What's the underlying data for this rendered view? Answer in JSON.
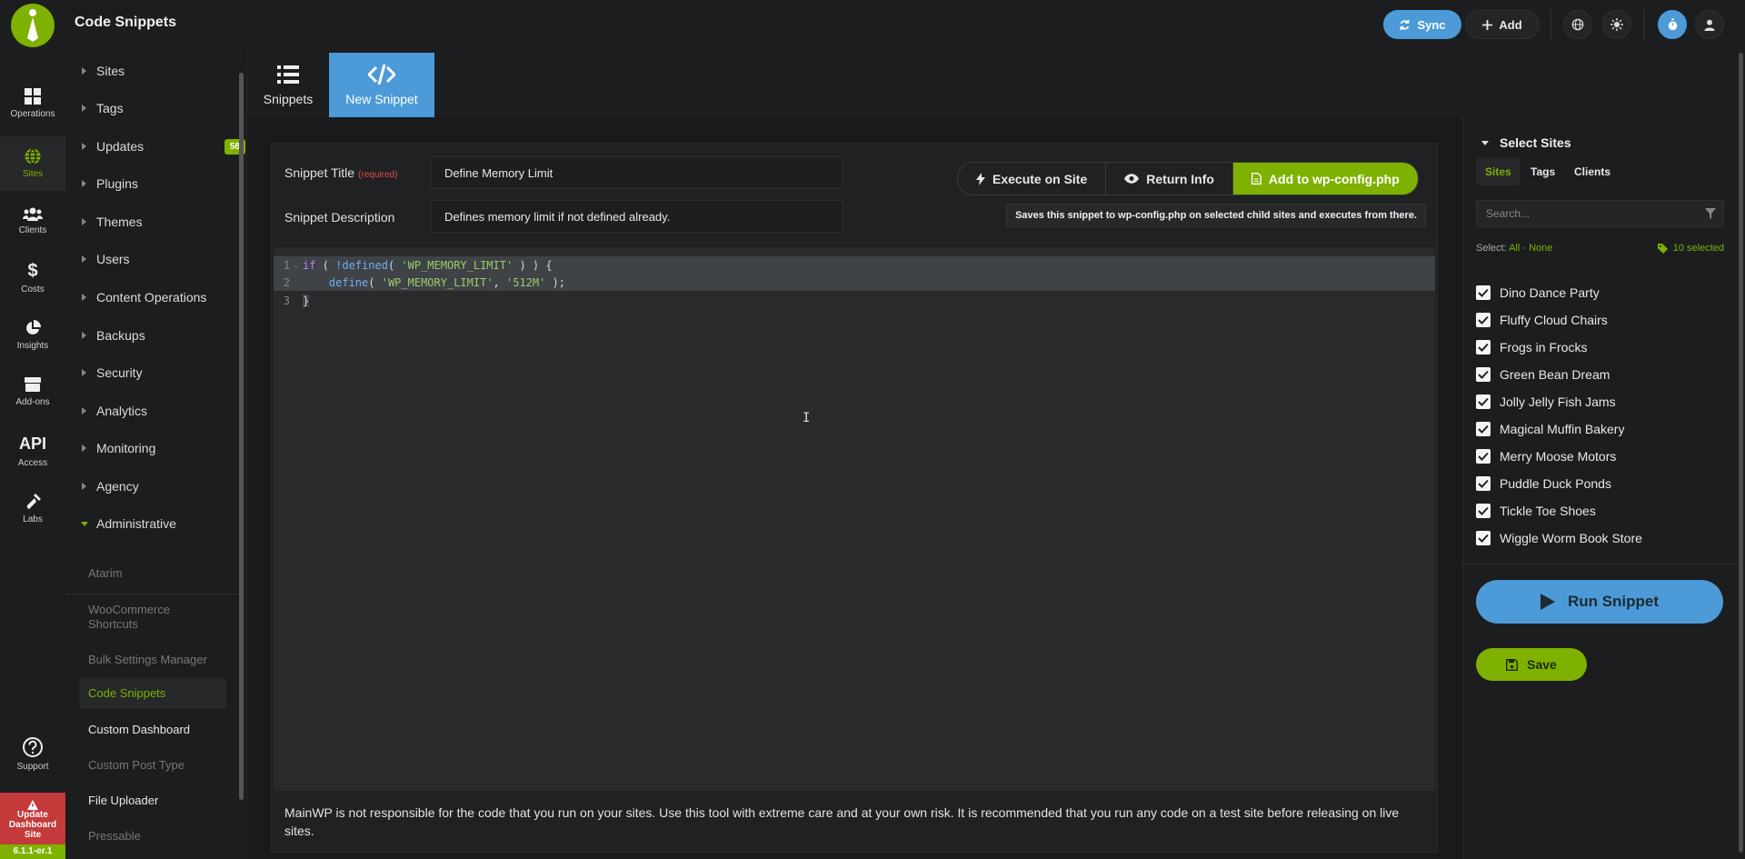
{
  "app": {
    "title": "Code Snippets",
    "version": "6.1.1-er.1"
  },
  "topbar": {
    "sync_label": "Sync",
    "add_label": "Add"
  },
  "iconbar": [
    {
      "label": "Operations",
      "icon": "grid-icon"
    },
    {
      "label": "Sites",
      "icon": "globe-icon"
    },
    {
      "label": "Clients",
      "icon": "users-icon"
    },
    {
      "label": "Costs",
      "icon": "dollar-icon"
    },
    {
      "label": "Insights",
      "icon": "pie-chart-icon"
    },
    {
      "label": "Add-ons",
      "icon": "box-icon"
    },
    {
      "label": "Access",
      "icon_text": "API"
    },
    {
      "label": "Labs",
      "icon": "flask-icon"
    },
    {
      "label": "Support",
      "icon": "help-icon"
    }
  ],
  "update_site": {
    "line1": "Update",
    "line2": "Dashboard",
    "line3": "Site"
  },
  "nav": {
    "items": [
      "Sites",
      "Tags",
      "Updates",
      "Plugins",
      "Themes",
      "Users",
      "Content Operations",
      "Backups",
      "Security",
      "Analytics",
      "Monitoring",
      "Agency",
      "Administrative"
    ],
    "updates_badge": "58",
    "sub_items": [
      "Atarim",
      "WooCommerce Shortcuts",
      "Bulk Settings Manager",
      "Code Snippets",
      "Custom Dashboard",
      "Custom Post Type",
      "File Uploader",
      "Pressable"
    ]
  },
  "tabs": {
    "snippets": "Snippets",
    "new_snippet": "New Snippet"
  },
  "form": {
    "title_label": "Snippet Title",
    "required_label": "(required)",
    "title_value": "Define Memory Limit",
    "desc_label": "Snippet Description",
    "desc_value": "Defines memory limit if not defined already."
  },
  "actions": {
    "execute": "Execute on Site",
    "return_info": "Return Info",
    "wp_config": "Add to wp-config.php",
    "tooltip": "Saves this snippet to wp-config.php on selected child sites and executes from there."
  },
  "code": {
    "line_numbers": [
      "1",
      "2",
      "3"
    ],
    "l1_kw": "if",
    "l1_a": " ( ",
    "l1_fn": "!defined",
    "l1_b": "( ",
    "l1_str": "'WP_MEMORY_LIMIT'",
    "l1_c": " ) ) {",
    "l2_indent": "    ",
    "l2_fn": "define",
    "l2_a": "( ",
    "l2_str1": "'WP_MEMORY_LIMIT'",
    "l2_b": ", ",
    "l2_str2": "'512M'",
    "l2_c": " );",
    "l3": "}"
  },
  "disclaimer": "MainWP is not responsible for the code that you run on your sites. Use this tool with extreme care and at your own risk. It is recommended that you run any code on a test site before releasing on live sites.",
  "sites_panel": {
    "title": "Select Sites",
    "tabs": [
      "Sites",
      "Tags",
      "Clients"
    ],
    "search_placeholder": "Search...",
    "select_label": "Select:",
    "all": "All",
    "dot": "·",
    "none": "None",
    "selected_count": "10 selected",
    "sites": [
      "Dino Dance Party",
      "Fluffy Cloud Chairs",
      "Frogs in Frocks",
      "Green Bean Dream",
      "Jolly Jelly Fish Jams",
      "Magical Muffin Bakery",
      "Merry Moose Motors",
      "Puddle Duck Ponds",
      "Tickle Toe Shoes",
      "Wiggle Worm Book Store"
    ],
    "run_label": "Run Snippet",
    "save_label": "Save"
  },
  "colors": {
    "accent_green": "#7fb100",
    "accent_blue": "#4c9bd8",
    "danger": "#c4393a"
  }
}
